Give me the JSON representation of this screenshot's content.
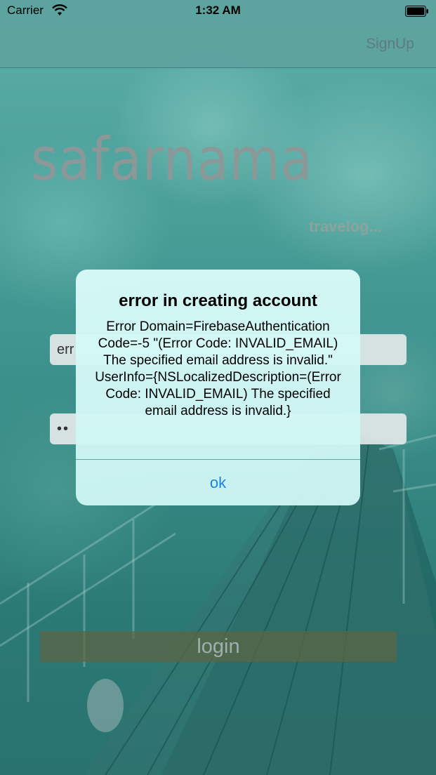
{
  "status_bar": {
    "carrier": "Carrier",
    "time": "1:32 AM",
    "wifi_icon": "wifi-icon",
    "battery_icon": "battery-full-icon"
  },
  "navbar": {
    "signup_label": "SignUp"
  },
  "brand": {
    "logo_text": "safarnama",
    "tagline": "travelog..."
  },
  "form": {
    "email_value": "err",
    "password_value": "••",
    "login_label": "login"
  },
  "alert": {
    "title": "error in creating account",
    "message": "Error Domain=FirebaseAuthentication Code=-5 \"(Error Code: INVALID_EMAIL) The specified email address is invalid.\" UserInfo={NSLocalizedDescription=(Error Code: INVALID_EMAIL) The specified email address is invalid.}",
    "ok_label": "ok"
  },
  "colors": {
    "accent": "#1a84e0",
    "navbar": "#60a6a2",
    "alert_bg": "#d7faf8"
  }
}
